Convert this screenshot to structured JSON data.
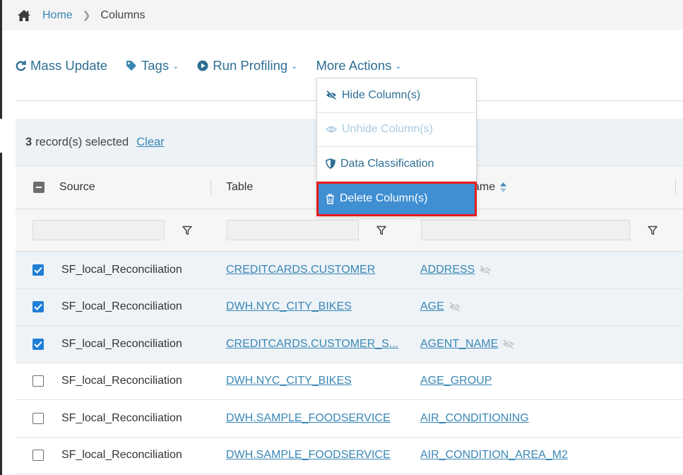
{
  "breadcrumb": {
    "home": "Home",
    "current": "Columns"
  },
  "toolbar": {
    "mass_update": "Mass Update",
    "tags": "Tags",
    "run_profiling": "Run Profiling",
    "more_actions": "More Actions"
  },
  "menu": {
    "hide": "Hide Column(s)",
    "unhide": "Unhide Column(s)",
    "classification": "Data Classification",
    "delete": "Delete Column(s)"
  },
  "selection": {
    "count": "3",
    "text": "record(s) selected",
    "clear": "Clear"
  },
  "columns": {
    "source": "Source",
    "table": "Table",
    "name_suffix": "ame"
  },
  "rows": [
    {
      "source": "SF_local_Reconciliation",
      "table": "CREDITCARDS.CUSTOMER",
      "name": "ADDRESS"
    },
    {
      "source": "SF_local_Reconciliation",
      "table": "DWH.NYC_CITY_BIKES",
      "name": "AGE"
    },
    {
      "source": "SF_local_Reconciliation",
      "table": "CREDITCARDS.CUSTOMER_S...",
      "name": "AGENT_NAME"
    },
    {
      "source": "SF_local_Reconciliation",
      "table": "DWH.NYC_CITY_BIKES",
      "name": "AGE_GROUP"
    },
    {
      "source": "SF_local_Reconciliation",
      "table": "DWH.SAMPLE_FOODSERVICE",
      "name": "AIR_CONDITIONING"
    },
    {
      "source": "SF_local_Reconciliation",
      "table": "DWH.SAMPLE_FOODSERVICE",
      "name": "AIR_CONDITION_AREA_M2"
    }
  ],
  "colors": {
    "link": "#3a87b5",
    "accent": "#3f8fd2",
    "highlight": "#e81b1b",
    "checkbox": "#1f7fd6"
  }
}
